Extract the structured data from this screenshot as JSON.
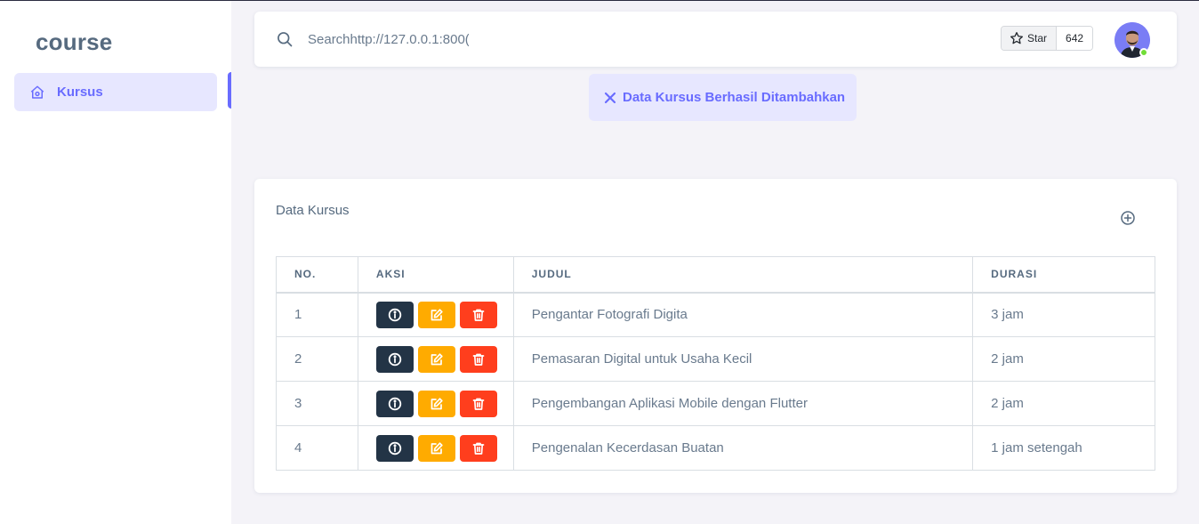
{
  "brand": "course",
  "sidebar": {
    "items": [
      {
        "label": "Kursus",
        "icon": "home-icon"
      }
    ]
  },
  "navbar": {
    "search_value": "Searchhttp://127.0.0.1:800(",
    "star_label": "Star",
    "star_count": "642"
  },
  "alert": {
    "message": "Data Kursus Berhasil Ditambahkan"
  },
  "card": {
    "title": "Data Kursus",
    "table": {
      "headers": [
        "NO.",
        "AKSI",
        "JUDUL",
        "DURASI"
      ],
      "rows": [
        {
          "no": "1",
          "judul": "Pengantar Fotografi Digita",
          "durasi": "3 jam"
        },
        {
          "no": "2",
          "judul": "Pemasaran Digital untuk Usaha Kecil",
          "durasi": "2 jam"
        },
        {
          "no": "3",
          "judul": "Pengembangan Aplikasi Mobile dengan Flutter",
          "durasi": "2 jam"
        },
        {
          "no": "4",
          "judul": "Pengenalan Kecerdasan Buatan",
          "durasi": "1 jam setengah"
        }
      ]
    }
  },
  "colors": {
    "primary": "#696cff",
    "info_button": "#233446",
    "edit_button": "#ffab00",
    "delete_button": "#ff3e1d",
    "online": "#71dd37"
  }
}
